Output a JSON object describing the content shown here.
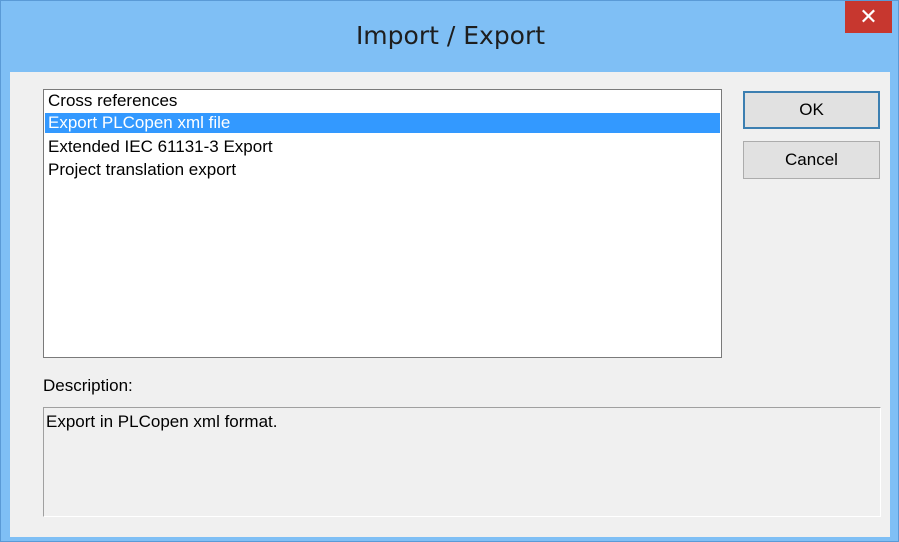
{
  "window": {
    "title": "Import / Export",
    "close_symbol": "✕"
  },
  "list": {
    "items": [
      {
        "label": "Cross references",
        "selected": false
      },
      {
        "label": "Export PLCopen xml file",
        "selected": true
      },
      {
        "label": "Extended IEC 61131-3 Export",
        "selected": false
      },
      {
        "label": "Project translation export",
        "selected": false
      }
    ]
  },
  "buttons": {
    "ok_label": "OK",
    "cancel_label": "Cancel"
  },
  "description": {
    "label": "Description:",
    "text": "Export in PLCopen xml format."
  },
  "colors": {
    "selection": "#3399ff",
    "titlebar": "#7fbff5",
    "close": "#c7372f"
  }
}
